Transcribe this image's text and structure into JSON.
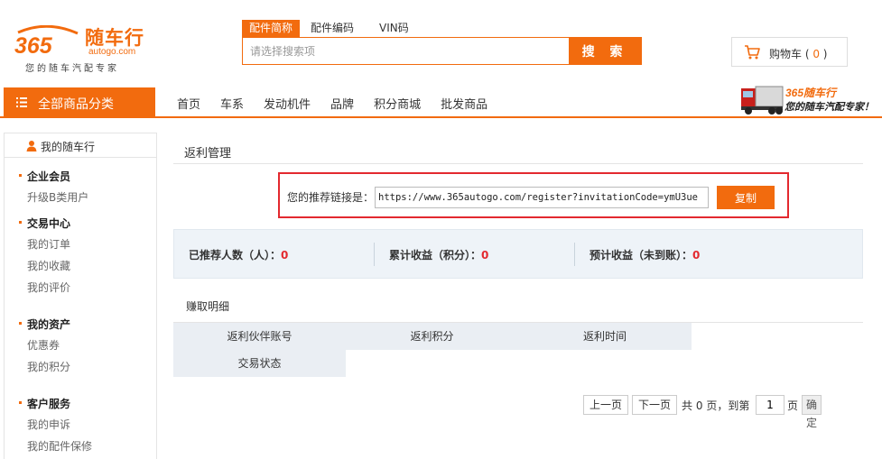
{
  "logo": {
    "mark": "365",
    "name_cn": "随车行",
    "domain": "autogo.com",
    "slogan": "您的随车汽配专家"
  },
  "search": {
    "tabs": [
      "配件简称",
      "配件编码",
      "VIN码"
    ],
    "active_tab": 0,
    "placeholder": "请选择搜索项",
    "button": "搜 索"
  },
  "cart": {
    "label": "购物车",
    "count": "0"
  },
  "nav": {
    "all_categories": "全部商品分类",
    "items": [
      "首页",
      "车系",
      "发动机件",
      "品牌",
      "积分商城",
      "批发商品"
    ]
  },
  "banner": {
    "line1": "365随车行",
    "line2": "您的随车汽配专家！"
  },
  "sidebar": {
    "title": "我的随车行",
    "groups": [
      {
        "title": "企业会员",
        "links": [
          "升级B类用户"
        ]
      },
      {
        "title": "交易中心",
        "links": [
          "我的订单",
          "我的收藏",
          "我的评价"
        ]
      },
      {
        "title": "我的资产",
        "links": [
          "优惠券",
          "我的积分"
        ]
      },
      {
        "title": "客户服务",
        "links": [
          "我的申诉",
          "我的配件保修"
        ]
      }
    ]
  },
  "main": {
    "title": "返利管理",
    "referral": {
      "label": "您的推荐链接是：",
      "link": "https://www.365autogo.com/register?invitationCode=ymU3ue",
      "copy_button": "复制"
    },
    "stats": [
      {
        "label": "已推荐人数（人）：",
        "value": "0"
      },
      {
        "label": "累计收益（积分）：",
        "value": "0"
      },
      {
        "label": "预计收益（未到账）：",
        "value": "0"
      }
    ],
    "detail_title": "赚取明细",
    "table_headers": [
      "返利伙伴账号",
      "返利积分",
      "返利时间",
      "交易状态"
    ]
  },
  "pagination": {
    "prev": "上一页",
    "next": "下一页",
    "total_prefix": "共",
    "total_pages": "0",
    "total_suffix": "页，到第",
    "current": "1",
    "page_suffix": "页",
    "confirm": "确定"
  },
  "colors": {
    "brand": "#f26b0e",
    "highlight": "#e3292f",
    "stats_bg": "#eef3f8",
    "table_head_bg": "#eaeef3"
  },
  "icons": [
    "cart-icon",
    "menu-icon",
    "user-icon",
    "truck-icon"
  ]
}
